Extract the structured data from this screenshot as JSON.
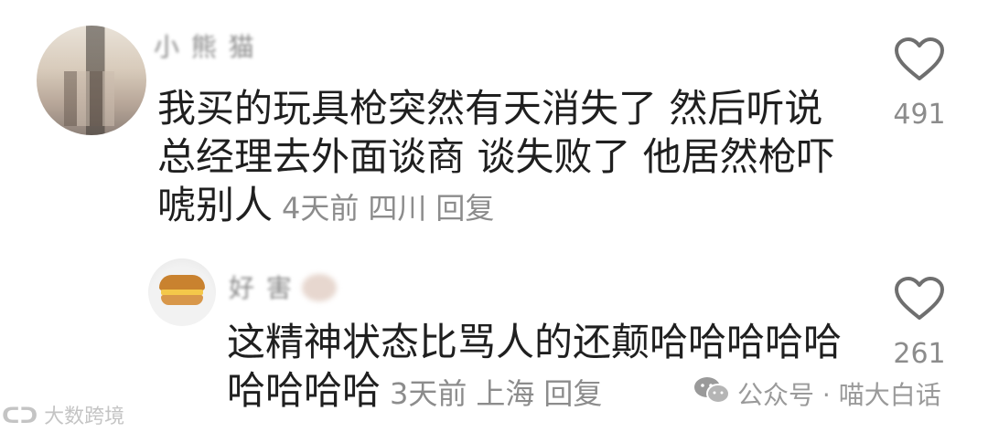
{
  "comments": [
    {
      "username": "小 熊 猫",
      "text_lines": [
        "我买的玩具枪突然有天消失了 然后听说",
        "总经理去外面谈商 谈失败了 他居然枪吓",
        "唬别人"
      ],
      "time": "4天前",
      "location": "四川",
      "reply_label": "回复",
      "likes": "491"
    },
    {
      "username": "好 害",
      "text_lines": [
        "这精神状态比骂人的还颠哈哈哈哈哈",
        "哈哈哈哈"
      ],
      "time": "3天前",
      "location": "上海",
      "reply_label": "回复",
      "likes": "261"
    }
  ],
  "watermarks": {
    "left": "大数跨境",
    "right": "公众号 · 喵大白话"
  },
  "icons": {
    "like": "heart-outline-icon",
    "wechat": "wechat-icon",
    "brand": "dashuju-logo-icon"
  },
  "colors": {
    "text": "#1f1f1f",
    "meta": "#8c8c8c",
    "icon": "#6f6f6f"
  }
}
